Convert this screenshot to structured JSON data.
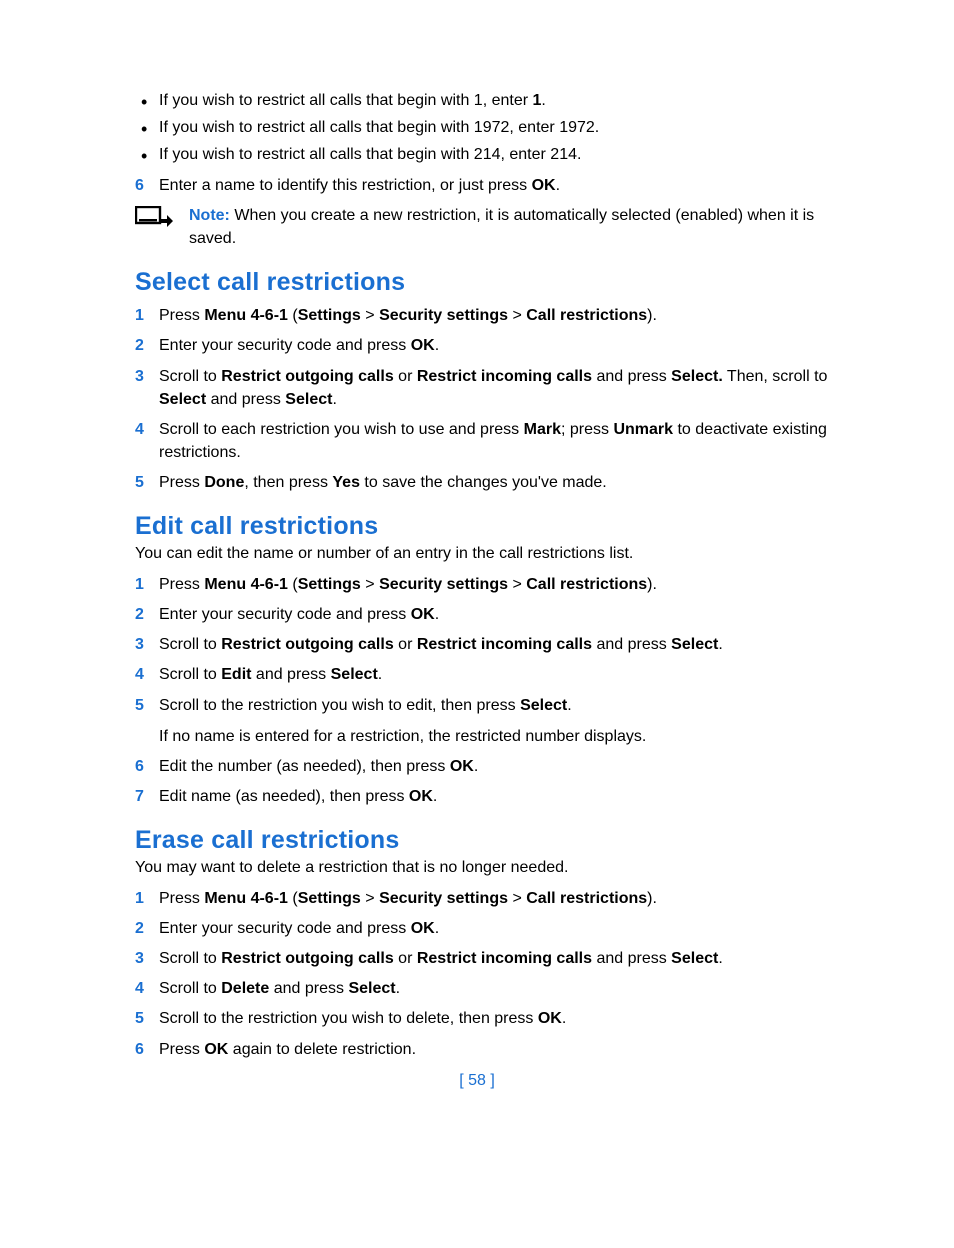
{
  "page_number": "[ 58 ]",
  "bullets": [
    {
      "pre": "If you wish to restrict all calls that begin with 1, enter ",
      "bold": "1",
      "post": "."
    },
    {
      "pre": "If you wish to restrict all calls that begin with 1972, enter 1972.",
      "bold": "",
      "post": ""
    },
    {
      "pre": "If you wish to restrict all calls that begin with 214, enter 214.",
      "bold": "",
      "post": ""
    }
  ],
  "step6_pre": "Enter a name to identify this restriction, or just press ",
  "step6_bold": "OK",
  "step6_post": ".",
  "note_label": "Note:",
  "note_text": " When you create a new restriction, it is automatically selected (enabled) when it is saved.",
  "select": {
    "heading": "Select call restrictions",
    "steps": {
      "s1": {
        "t0": "Press ",
        "b0": "Menu 4-6-1",
        "t1": " (",
        "b1": "Settings",
        "t2": " > ",
        "b2": "Security settings",
        "t3": " > ",
        "b3": "Call restrictions",
        "t4": ")."
      },
      "s2": {
        "t0": "Enter your security code and press ",
        "b0": "OK",
        "t1": "."
      },
      "s3": {
        "t0": "Scroll to ",
        "b0": "Restrict outgoing calls",
        "t1": " or ",
        "b1": "Restrict incoming calls",
        "t2": " and press ",
        "b2": "Select.",
        "t3": " Then, scroll to ",
        "b3": "Select",
        "t4": " and press ",
        "b4": "Select",
        "t5": "."
      },
      "s4": {
        "t0": "Scroll to each restriction you wish to use and press ",
        "b0": "Mark",
        "t1": "; press ",
        "b1": "Unmark",
        "t2": " to deactivate existing restrictions."
      },
      "s5": {
        "t0": "Press ",
        "b0": "Done",
        "t1": ", then press ",
        "b1": "Yes",
        "t2": " to save the changes you've made."
      }
    }
  },
  "edit": {
    "heading": "Edit call restrictions",
    "intro": "You can edit the name or number of an entry in the call restrictions list.",
    "steps": {
      "s1": {
        "t0": "Press ",
        "b0": "Menu 4-6-1",
        "t1": " (",
        "b1": "Settings",
        "t2": " > ",
        "b2": "Security settings",
        "t3": " > ",
        "b3": "Call restrictions",
        "t4": ")."
      },
      "s2": {
        "t0": "Enter your security code and press ",
        "b0": "OK",
        "t1": "."
      },
      "s3": {
        "t0": "Scroll to ",
        "b0": "Restrict outgoing calls",
        "t1": " or ",
        "b1": "Restrict incoming calls",
        "t2": " and press ",
        "b2": "Select",
        "t3": "."
      },
      "s4": {
        "t0": "Scroll to ",
        "b0": "Edit",
        "t1": " and press ",
        "b1": "Select",
        "t2": "."
      },
      "s5": {
        "t0": "Scroll to the restriction you wish to edit, then press ",
        "b0": "Select",
        "t1": "."
      },
      "s5sub": "If no name is entered for a restriction, the restricted number displays.",
      "s6": {
        "t0": "Edit the number (as needed), then press ",
        "b0": "OK",
        "t1": "."
      },
      "s7": {
        "t0": "Edit name (as needed), then press ",
        "b0": "OK",
        "t1": "."
      }
    }
  },
  "erase": {
    "heading": "Erase call restrictions",
    "intro": "You may want to delete a restriction that is no longer needed.",
    "steps": {
      "s1": {
        "t0": "Press ",
        "b0": "Menu 4-6-1",
        "t1": " (",
        "b1": "Settings",
        "t2": " > ",
        "b2": "Security settings",
        "t3": " > ",
        "b3": "Call restrictions",
        "t4": ")."
      },
      "s2": {
        "t0": "Enter your security code and press ",
        "b0": "OK",
        "t1": "."
      },
      "s3": {
        "t0": "Scroll to ",
        "b0": "Restrict outgoing calls",
        "t1": " or ",
        "b1": "Restrict incoming calls",
        "t2": " and press ",
        "b2": "Select",
        "t3": "."
      },
      "s4": {
        "t0": "Scroll to ",
        "b0": "Delete",
        "t1": " and press ",
        "b1": "Select",
        "t2": "."
      },
      "s5": {
        "t0": "Scroll to the restriction you wish to delete, then press ",
        "b0": "OK",
        "t1": "."
      },
      "s6": {
        "t0": "Press ",
        "b0": "OK",
        "t1": " again to delete restriction."
      }
    }
  }
}
